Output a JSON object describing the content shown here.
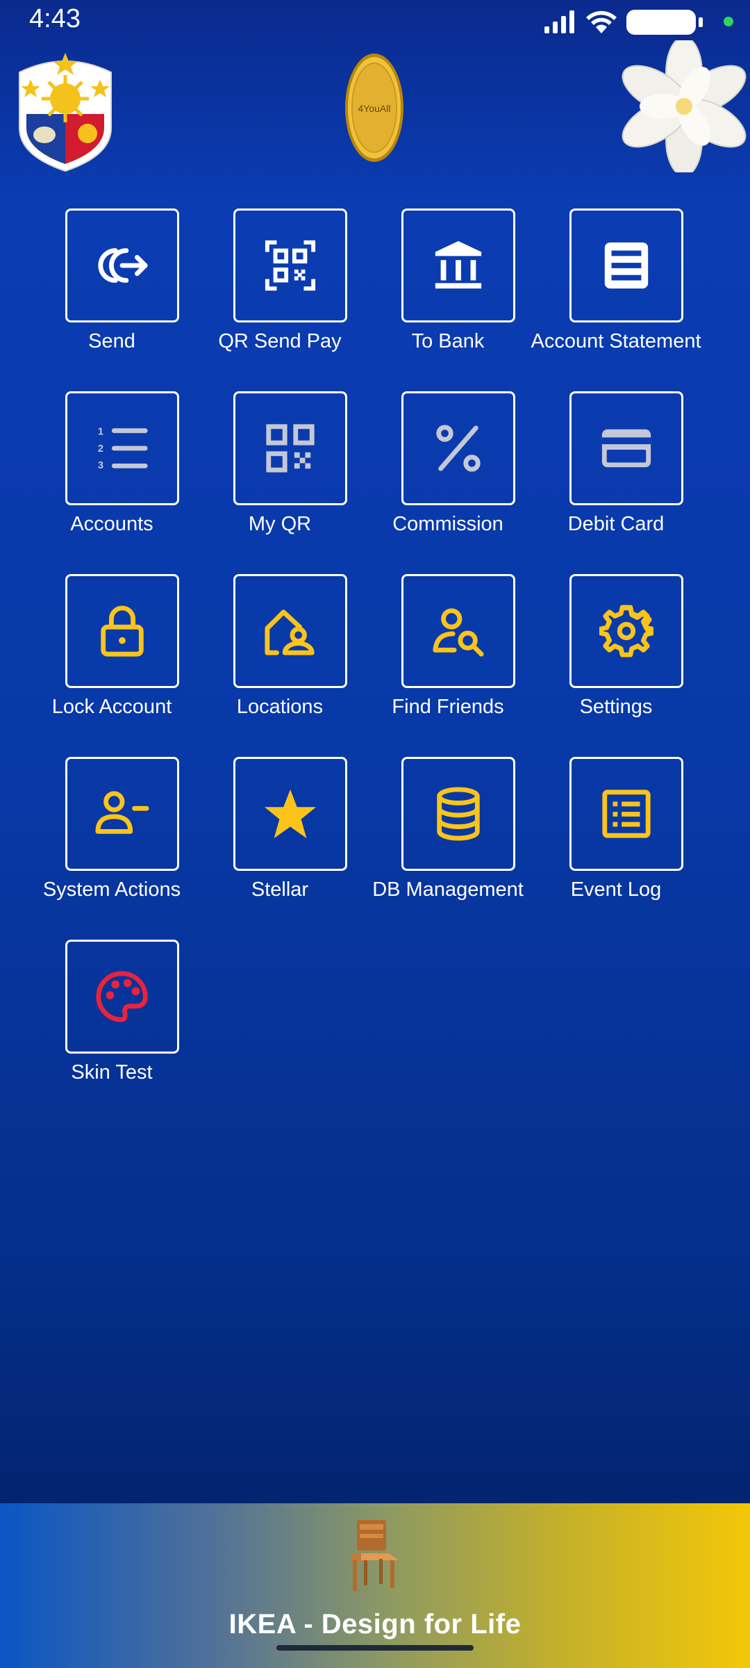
{
  "status_bar": {
    "time": "4:43",
    "icons": [
      "signal-icon",
      "wifi-icon",
      "battery-icon",
      "privacy-dot-icon"
    ]
  },
  "header": {
    "left_logo": "philippine-seal-logo",
    "center_logo": "gold-coin-logo",
    "center_logo_text": "4YouAll",
    "right_logo": "white-flower-image"
  },
  "menu": {
    "tiles": [
      {
        "label": "Send",
        "icon": "send-arrow-icon"
      },
      {
        "label": "QR Send Pay",
        "icon": "qr-scan-icon"
      },
      {
        "label": "To Bank",
        "icon": "bank-icon"
      },
      {
        "label": "Account Statement",
        "icon": "statement-icon"
      },
      {
        "label": "Accounts",
        "icon": "numbered-list-icon"
      },
      {
        "label": "My QR",
        "icon": "qr-code-icon"
      },
      {
        "label": "Commission",
        "icon": "percent-icon"
      },
      {
        "label": "Debit Card",
        "icon": "credit-card-icon"
      },
      {
        "label": "Lock Account",
        "icon": "lock-icon"
      },
      {
        "label": "Locations",
        "icon": "home-person-icon"
      },
      {
        "label": "Find Friends",
        "icon": "person-search-icon"
      },
      {
        "label": "Settings",
        "icon": "gear-icon"
      },
      {
        "label": "System Actions",
        "icon": "person-remove-icon"
      },
      {
        "label": "Stellar",
        "icon": "star-icon"
      },
      {
        "label": "DB Management",
        "icon": "database-icon"
      },
      {
        "label": "Event Log",
        "icon": "list-document-icon"
      },
      {
        "label": "Skin Test",
        "icon": "palette-icon"
      }
    ]
  },
  "ad": {
    "title": "IKEA - Design for Life",
    "icon": "chair-icon"
  },
  "colors": {
    "background_top": "#0a2a8e",
    "background_mid": "#0b3cb2",
    "icon_white": "#ffffff",
    "icon_gray": "#c4c8d6",
    "icon_gold": "#fcc419",
    "icon_red": "#e8233c",
    "ad_gradient_start": "#0a56c4",
    "ad_gradient_end": "#f3c708"
  }
}
